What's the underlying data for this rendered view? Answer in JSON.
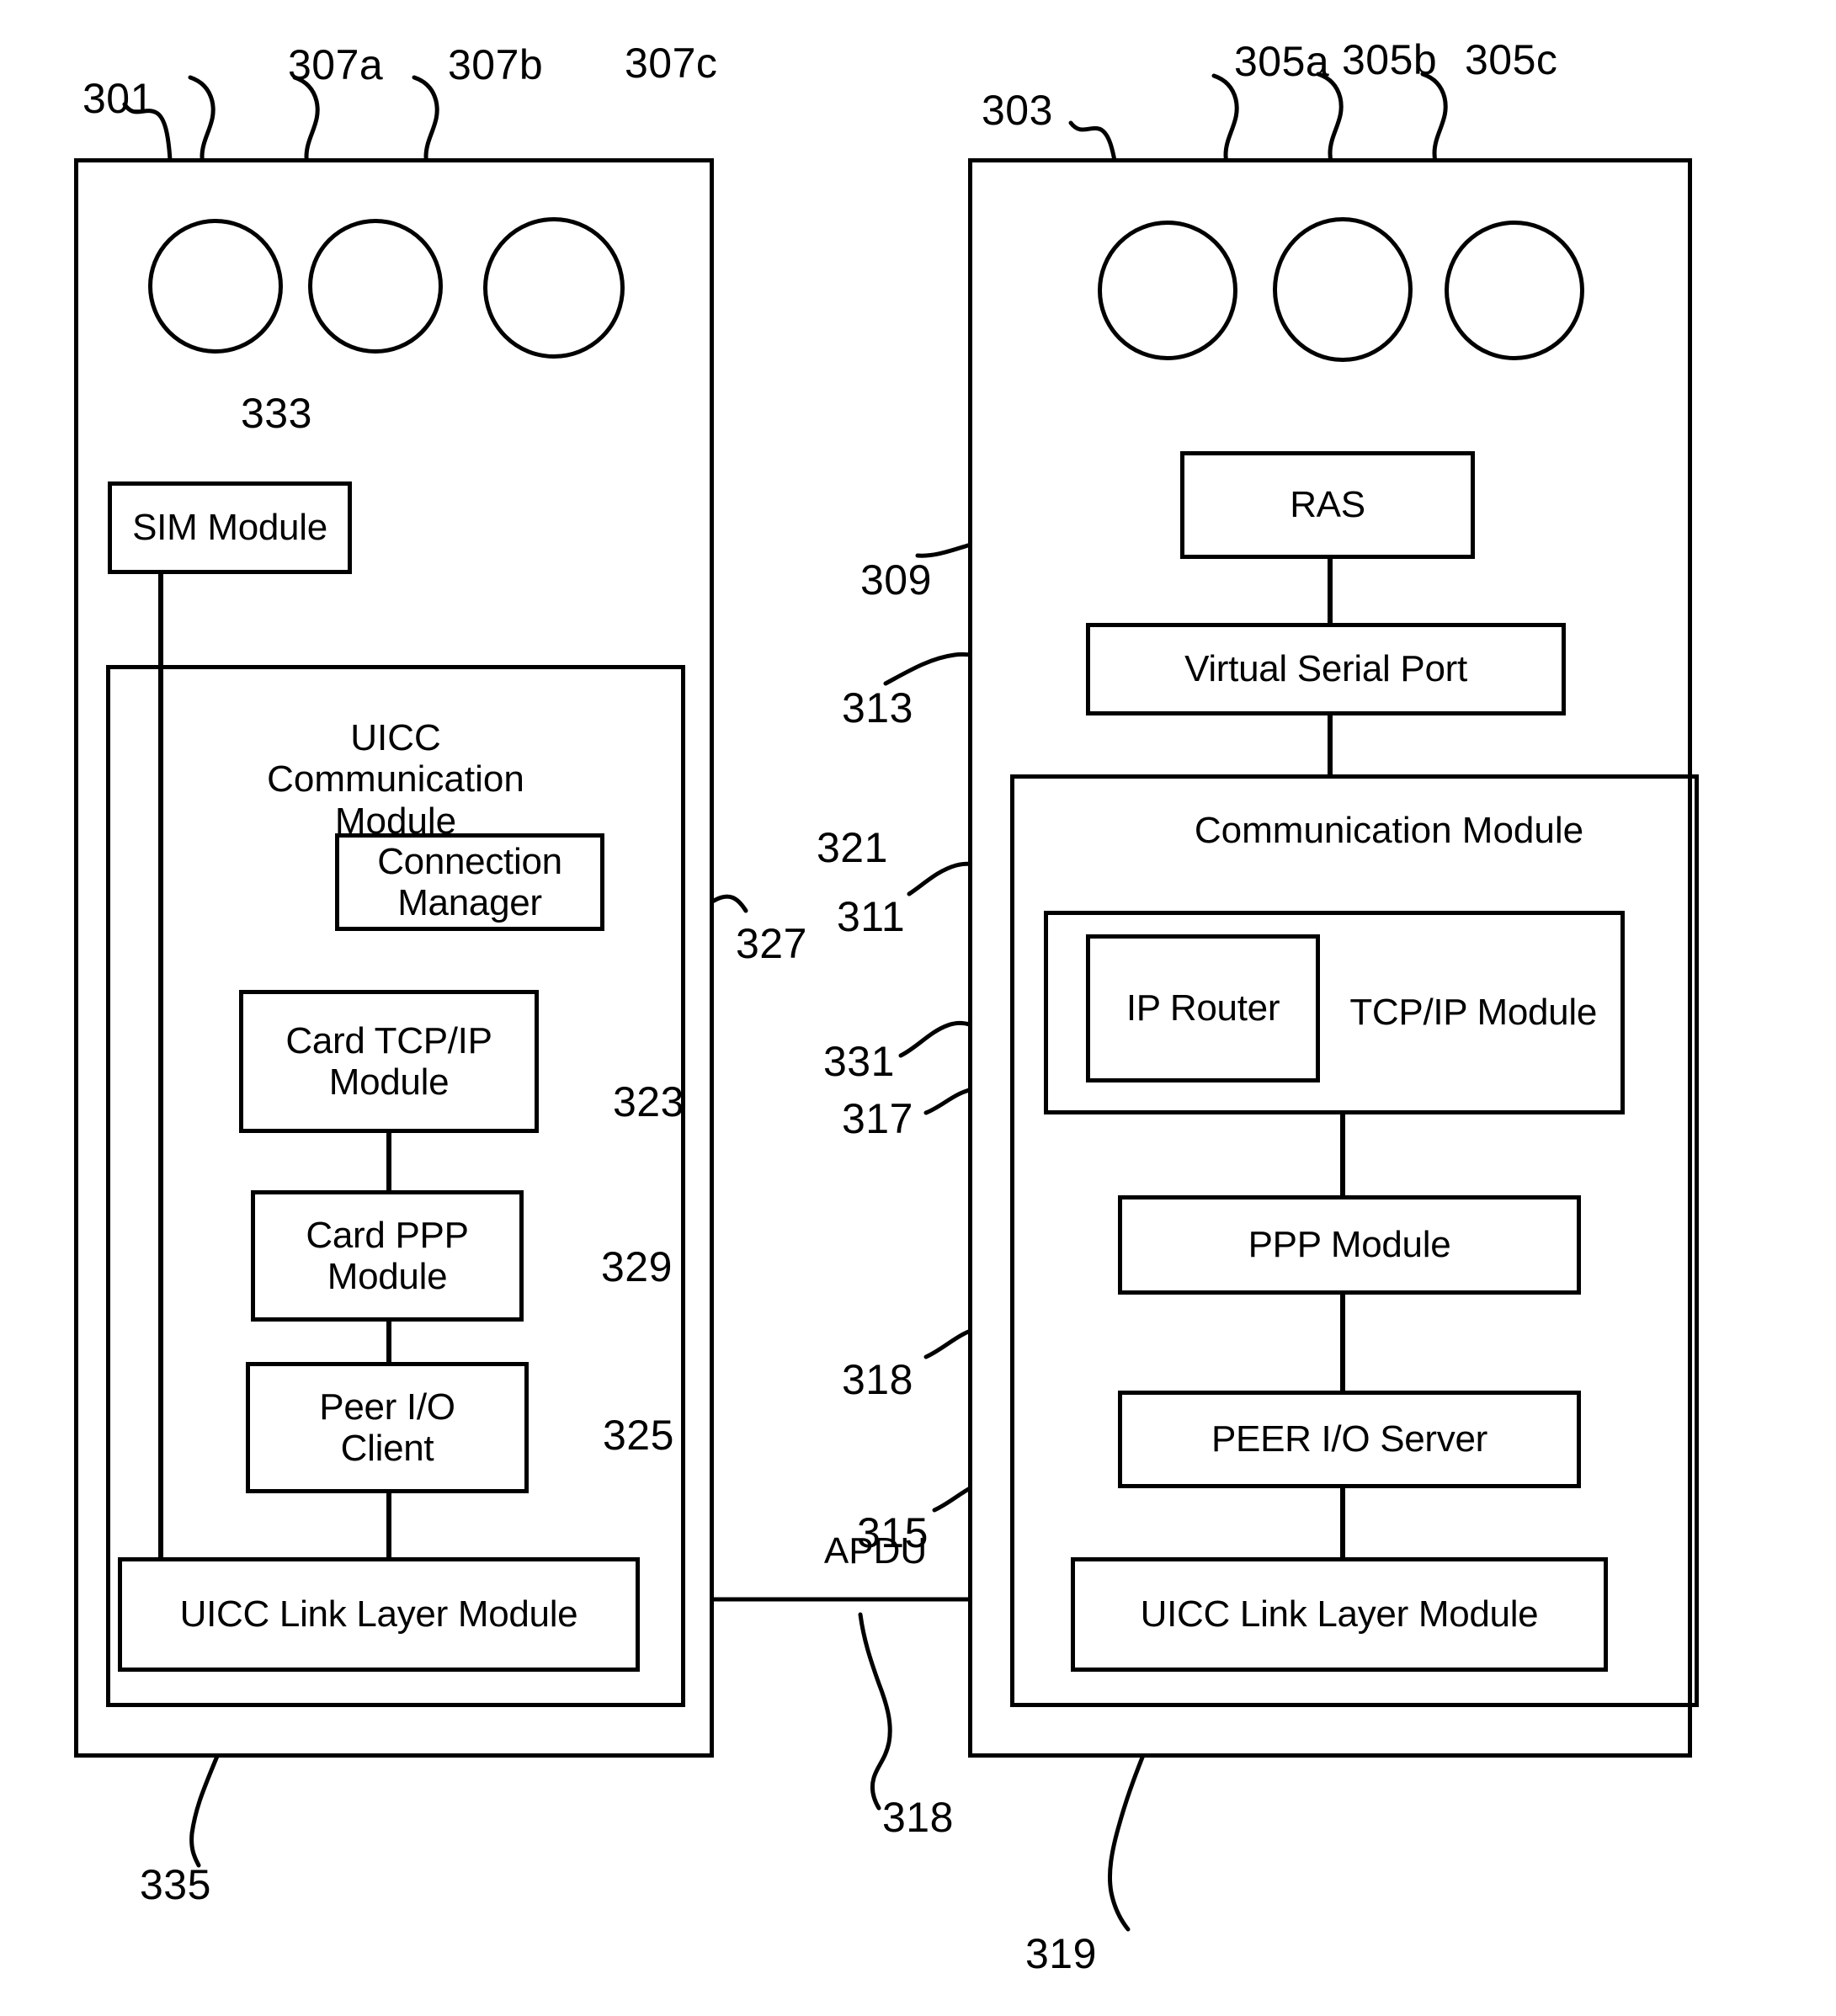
{
  "figure": {
    "left_panel": {
      "ref": "301",
      "antennas": [
        {
          "ref": "307a"
        },
        {
          "ref": "307b"
        },
        {
          "ref": "307c"
        }
      ],
      "sim_module": {
        "label": "SIM Module",
        "ref": "333"
      },
      "uicc_comm_module": {
        "label": "UICC\nCommunication Module",
        "ref": "321",
        "children": [
          {
            "label": "Connection\nManager",
            "ref": "327"
          },
          {
            "label": "Card TCP/IP\nModule",
            "ref": "323"
          },
          {
            "label": "Card PPP\nModule",
            "ref": "329"
          },
          {
            "label": "Peer I/O\nClient",
            "ref": "325"
          }
        ]
      },
      "link_layer": {
        "label": "UICC Link Layer Module",
        "ref": "335"
      }
    },
    "right_panel": {
      "ref": "303",
      "antennas": [
        {
          "ref": "305a"
        },
        {
          "ref": "305b"
        },
        {
          "ref": "305c"
        }
      ],
      "ras": {
        "label": "RAS",
        "ref": "309"
      },
      "virtual_serial_port": {
        "label": "Virtual Serial Port",
        "ref": "313"
      },
      "comm_module": {
        "label": "Communication Module",
        "ref": "311",
        "tcpip_module": {
          "label": "TCP/IP Module",
          "ref": "317"
        },
        "ip_router": {
          "label": "IP Router",
          "ref": "331"
        },
        "ppp_module": {
          "label": "PPP Module",
          "ref": "318"
        },
        "peer_io_server": {
          "label": "PEER I/O Server",
          "ref": "315"
        }
      },
      "link_layer": {
        "label": "UICC Link Layer Module",
        "ref": "319"
      }
    },
    "interface": {
      "label": "APDU",
      "ref": "318"
    },
    "colors": {
      "stroke": "#000000",
      "background": "#ffffff"
    }
  }
}
